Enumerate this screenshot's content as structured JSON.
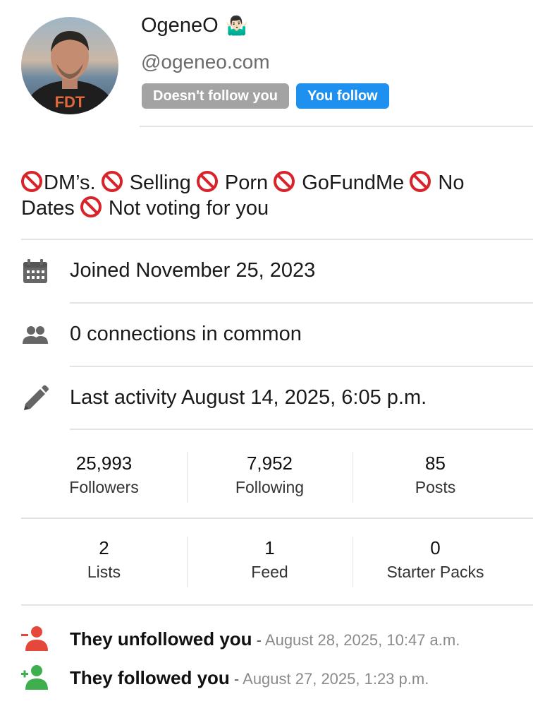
{
  "profile": {
    "display_name": "OgeneO",
    "name_emoji": "🤷🏻‍♂️",
    "handle": "@ogeneo.com",
    "avatar_shirt_text": "FDT",
    "badges": {
      "not_following": "Doesn't follow you",
      "you_follow": "You follow"
    },
    "bio": {
      "segments": [
        "DM’s. ",
        " Selling ",
        " Porn ",
        " GoFundMe ",
        " No Dates ",
        " Not voting for you"
      ]
    }
  },
  "info": {
    "joined": "Joined November 25, 2023",
    "connections": "0 connections in common",
    "last_activity": "Last activity August 14, 2025, 6:05 p.m."
  },
  "stats_row1": [
    {
      "value": "25,993",
      "label": "Followers"
    },
    {
      "value": "7,952",
      "label": "Following"
    },
    {
      "value": "85",
      "label": "Posts"
    }
  ],
  "stats_row2": [
    {
      "value": "2",
      "label": "Lists"
    },
    {
      "value": "1",
      "label": "Feed"
    },
    {
      "value": "0",
      "label": "Starter Packs"
    }
  ],
  "activity": [
    {
      "text": "They unfollowed you",
      "sep": " - ",
      "date": "August 28, 2025, 10:47 a.m.",
      "icon": "user-minus-icon",
      "color": "#e5483a"
    },
    {
      "text": "They followed you",
      "sep": " - ",
      "date": "August 27, 2025, 1:23 p.m.",
      "icon": "user-plus-icon",
      "color": "#3fae4f"
    }
  ],
  "colors": {
    "accent_blue": "#1e90f0",
    "badge_grey": "#a3a3a3",
    "no_symbol_red": "#d8232a",
    "icon_grey": "#666666"
  }
}
